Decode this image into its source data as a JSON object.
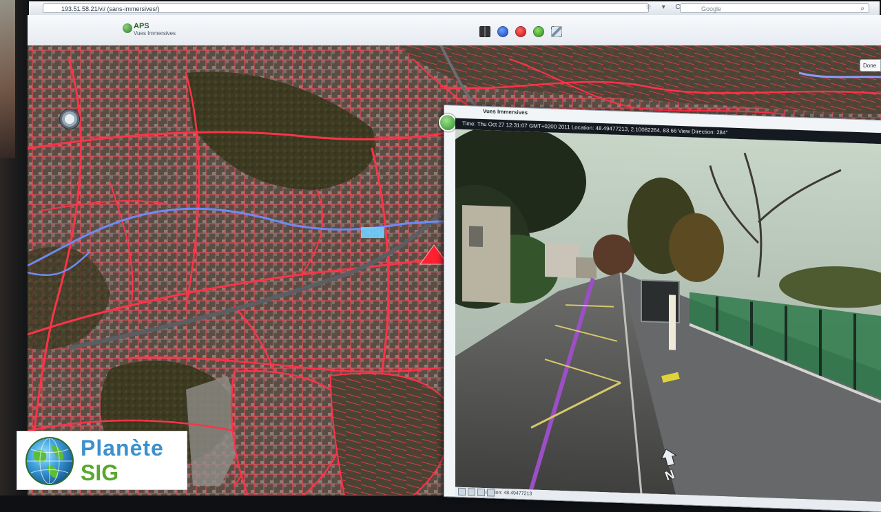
{
  "browser": {
    "url": "193.51.58.21/vi/ (sans-immersives/)",
    "search_placeholder": "Google",
    "url_tools": "☆ ▾ C"
  },
  "app": {
    "logo_text": "APS",
    "logo_subtitle": "Vues Immersives"
  },
  "map_tab": {
    "label": "Done"
  },
  "viewer": {
    "title": "Vues Immersives",
    "status": "Time: Thu Oct 27 12:31:07 GMT+0200 2011  Location: 48.49477213, 2.10082264, 83.66  View Direction: 284°",
    "footer": "Location: 48.49477213",
    "compass_label": "N"
  },
  "watermark": {
    "line1": "Planète",
    "line2": "SIG"
  },
  "colors": {
    "parcel_lines": "#ff3b4e",
    "river": "#6f8cff",
    "accent_green": "#2d8a2a",
    "watermark_blue": "#3a91cf",
    "watermark_green": "#5aa731"
  }
}
